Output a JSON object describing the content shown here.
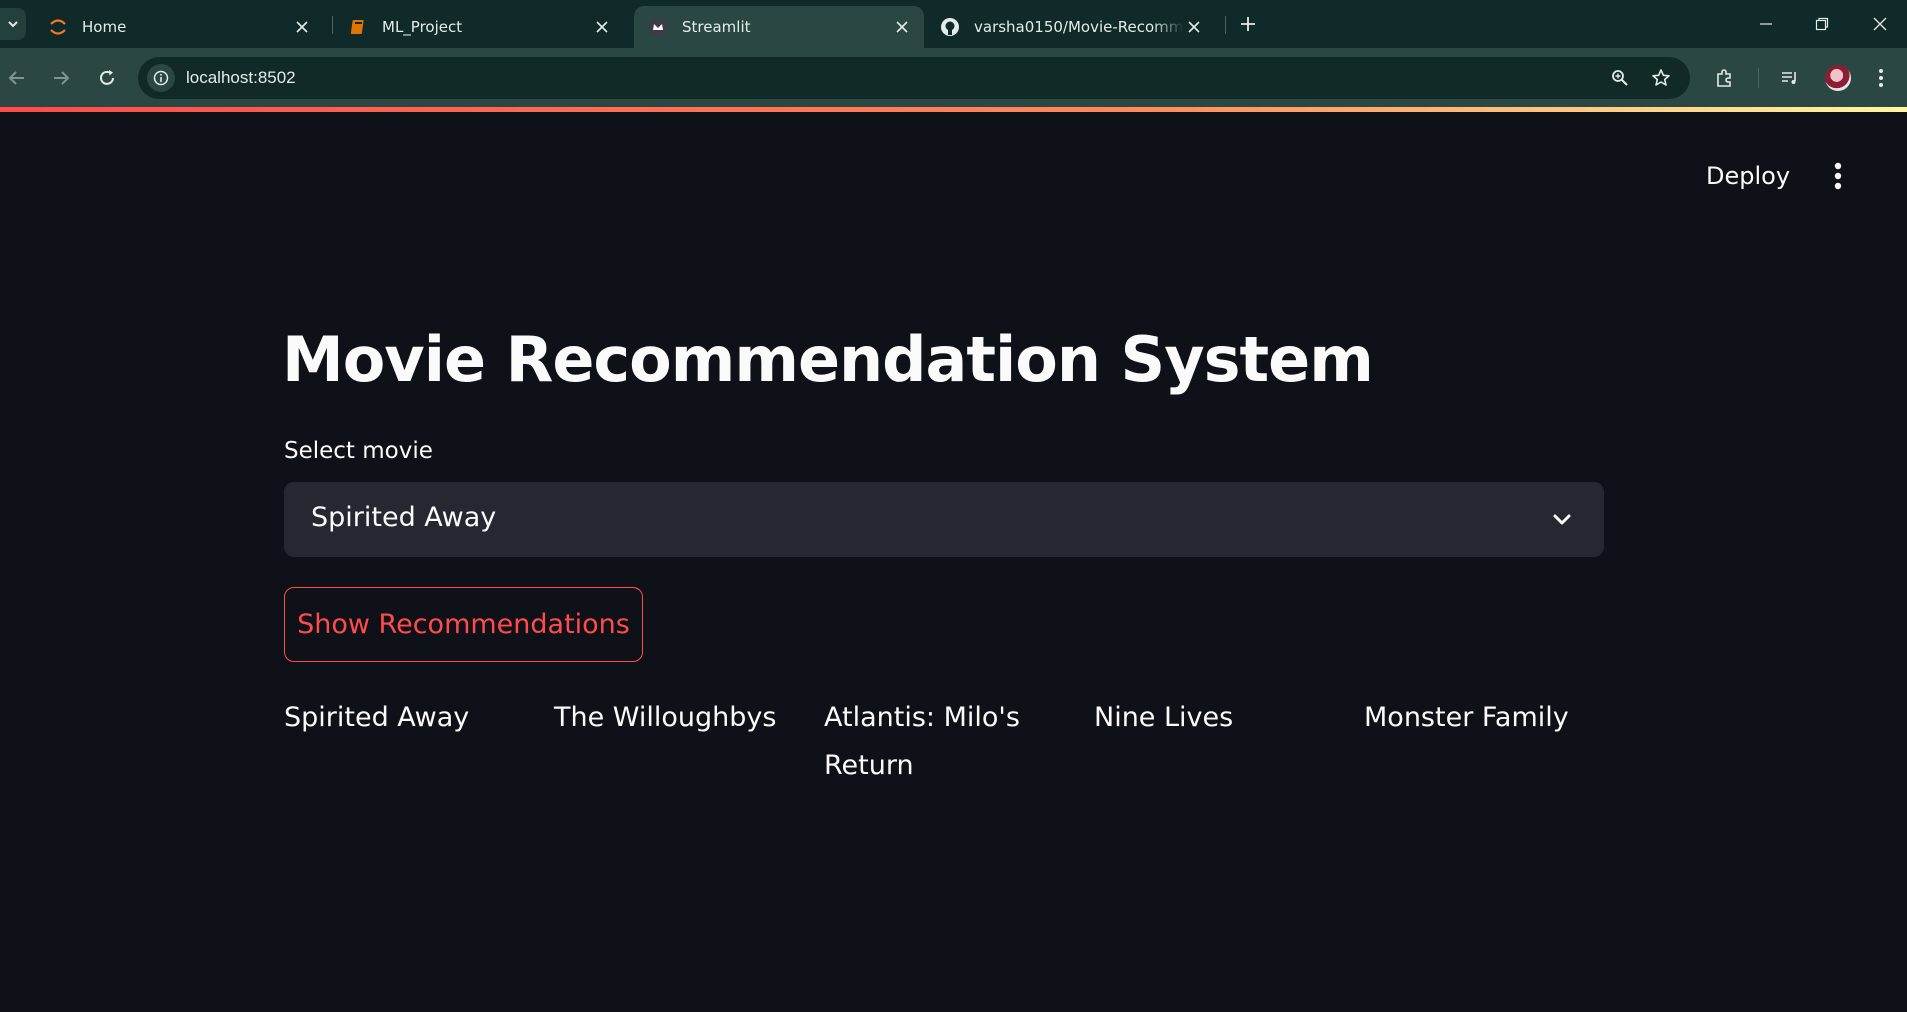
{
  "browser": {
    "tabs": [
      {
        "title": "Home",
        "icon": "jupyter-icon"
      },
      {
        "title": "ML_Project",
        "icon": "notebook-icon"
      },
      {
        "title": "Streamlit",
        "icon": "streamlit-icon",
        "active": true
      },
      {
        "title": "varsha0150/Movie-Recommendation",
        "icon": "github-icon"
      }
    ],
    "url": "localhost:8502"
  },
  "header": {
    "deploy_label": "Deploy"
  },
  "main": {
    "title": "Movie Recommendation System",
    "select_label": "Select movie",
    "selected_movie": "Spirited Away",
    "button_label": "Show Recommendations",
    "recommendations": [
      "Spirited Away",
      "The Willoughbys",
      "Atlantis: Milo's Return",
      "Nine Lives",
      "Monster Family"
    ]
  },
  "colors": {
    "background": "#0e1117",
    "accent": "#ff4b4b",
    "select_bg": "#262730",
    "chrome": "#2a4743"
  }
}
